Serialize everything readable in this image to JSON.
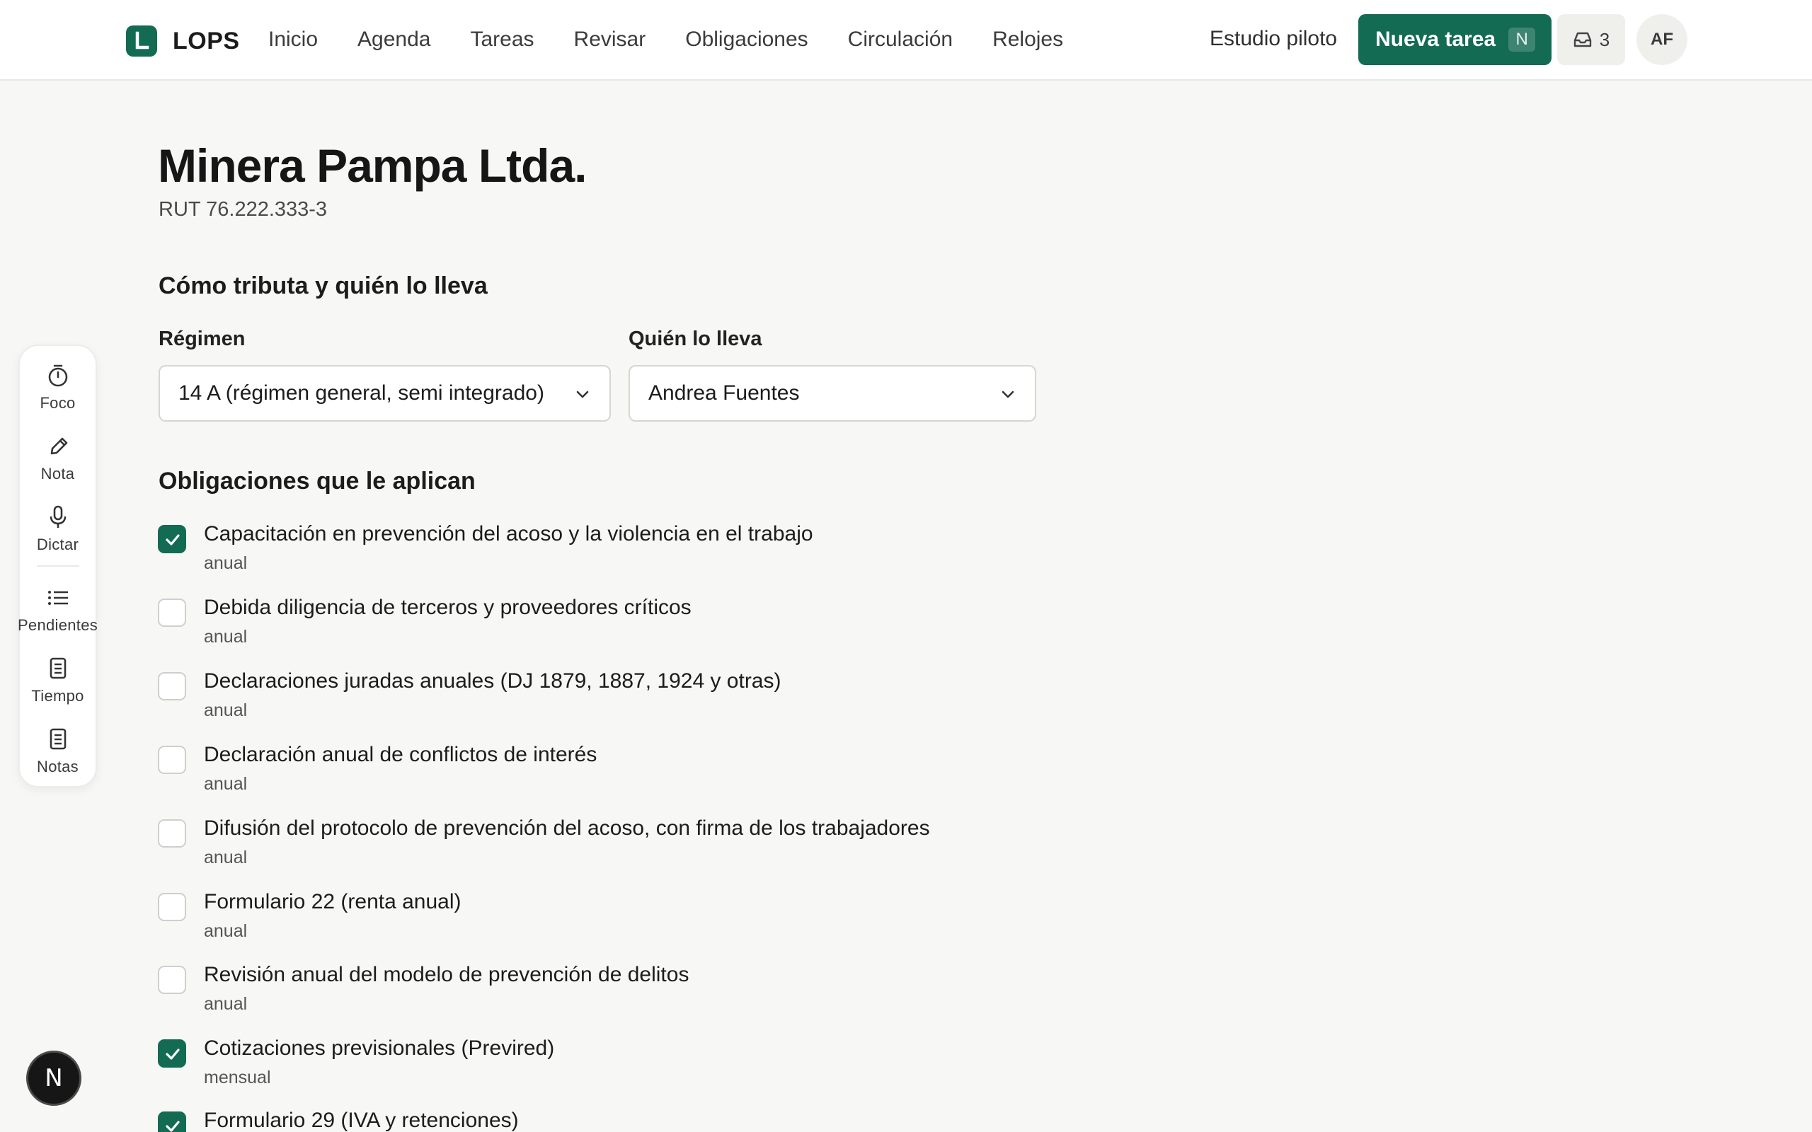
{
  "app": {
    "name": "LOPS"
  },
  "nav": [
    "Inicio",
    "Agenda",
    "Tareas",
    "Revisar",
    "Obligaciones",
    "Circulación",
    "Relojes"
  ],
  "header": {
    "studio": "Estudio piloto",
    "new_task_label": "Nueva tarea",
    "new_task_shortcut": "N",
    "inbox_count": "3",
    "avatar_initials": "AF"
  },
  "rail": [
    {
      "label": "Foco",
      "icon": "timer-icon"
    },
    {
      "label": "Nota",
      "icon": "pencil-icon"
    },
    {
      "label": "Dictar",
      "icon": "microphone-icon"
    },
    {
      "label": "Pendientes",
      "icon": "list-icon"
    },
    {
      "label": "Tiempo",
      "icon": "document-icon"
    },
    {
      "label": "Notas",
      "icon": "document-icon"
    }
  ],
  "company": {
    "name": "Minera Pampa Ltda.",
    "rut": "RUT 76.222.333-3"
  },
  "tax_section": {
    "title": "Cómo tributa y quién lo lleva",
    "regime_label": "Régimen",
    "regime_value": "14 A (régimen general, semi integrado)",
    "owner_label": "Quién lo lleva",
    "owner_value": "Andrea Fuentes"
  },
  "obligations_section": {
    "title": "Obligaciones que le aplican",
    "items": [
      {
        "name": "Capacitación en prevención del acoso y la violencia en el trabajo",
        "frequency": "anual",
        "checked": true
      },
      {
        "name": "Debida diligencia de terceros y proveedores críticos",
        "frequency": "anual",
        "checked": false
      },
      {
        "name": "Declaraciones juradas anuales (DJ 1879, 1887, 1924 y otras)",
        "frequency": "anual",
        "checked": false
      },
      {
        "name": "Declaración anual de conflictos de interés",
        "frequency": "anual",
        "checked": false
      },
      {
        "name": "Difusión del protocolo de prevención del acoso, con firma de los trabajadores",
        "frequency": "anual",
        "checked": false
      },
      {
        "name": "Formulario 22 (renta anual)",
        "frequency": "anual",
        "checked": false
      },
      {
        "name": "Revisión anual del modelo de prevención de delitos",
        "frequency": "anual",
        "checked": false
      },
      {
        "name": "Cotizaciones previsionales (Previred)",
        "frequency": "mensual",
        "checked": true
      },
      {
        "name": "Formulario 29 (IVA y retenciones)",
        "frequency": "",
        "checked": true
      }
    ]
  },
  "fab": {
    "label": "N"
  },
  "colors": {
    "accent": "#136b54",
    "background": "#f7f7f6"
  }
}
